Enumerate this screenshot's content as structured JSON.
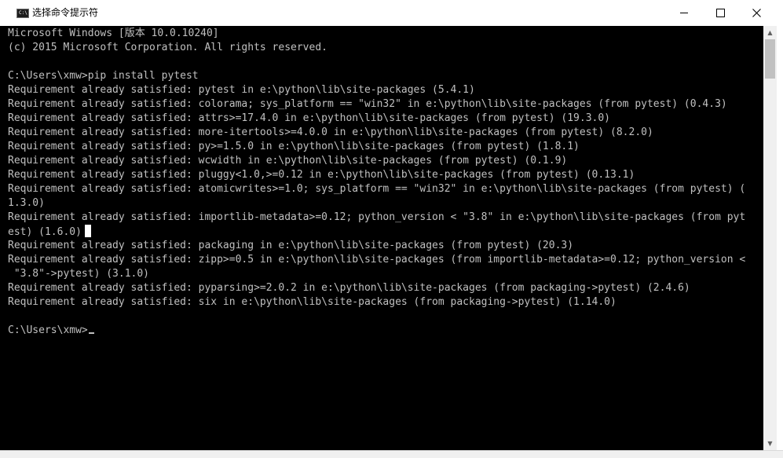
{
  "window": {
    "title": "选择命令提示符",
    "icon_label": "C:\\",
    "controls": {
      "minimize": "minimize",
      "maximize": "maximize",
      "close": "close"
    }
  },
  "console": {
    "lines": [
      "Microsoft Windows [版本 10.0.10240]",
      "(c) 2015 Microsoft Corporation. All rights reserved.",
      "",
      "C:\\Users\\xmw>pip install pytest",
      "Requirement already satisfied: pytest in e:\\python\\lib\\site-packages (5.4.1)",
      "Requirement already satisfied: colorama; sys_platform == \"win32\" in e:\\python\\lib\\site-packages (from pytest) (0.4.3)",
      "Requirement already satisfied: attrs>=17.4.0 in e:\\python\\lib\\site-packages (from pytest) (19.3.0)",
      "Requirement already satisfied: more-itertools>=4.0.0 in e:\\python\\lib\\site-packages (from pytest) (8.2.0)",
      "Requirement already satisfied: py>=1.5.0 in e:\\python\\lib\\site-packages (from pytest) (1.8.1)",
      "Requirement already satisfied: wcwidth in e:\\python\\lib\\site-packages (from pytest) (0.1.9)",
      "Requirement already satisfied: pluggy<1.0,>=0.12 in e:\\python\\lib\\site-packages (from pytest) (0.13.1)",
      "Requirement already satisfied: atomicwrites>=1.0; sys_platform == \"win32\" in e:\\python\\lib\\site-packages (from pytest) (",
      "1.3.0)",
      "Requirement already satisfied: importlib-metadata>=0.12; python_version < \"3.8\" in e:\\python\\lib\\site-packages (from pyt",
      "est) (1.6.0)",
      "Requirement already satisfied: packaging in e:\\python\\lib\\site-packages (from pytest) (20.3)",
      "Requirement already satisfied: zipp>=0.5 in e:\\python\\lib\\site-packages (from importlib-metadata>=0.12; python_version <",
      " \"3.8\"->pytest) (3.1.0)",
      "Requirement already satisfied: pyparsing>=2.0.2 in e:\\python\\lib\\site-packages (from packaging->pytest) (2.4.6)",
      "Requirement already satisfied: six in e:\\python\\lib\\site-packages (from packaging->pytest) (1.14.0)",
      "",
      "C:\\Users\\xmw>"
    ],
    "selection_cursor_line": 14,
    "prompt_cursor_line": 21,
    "colors": {
      "background": "#000000",
      "text": "#c0c0c0",
      "selection_cursor": "#ffffff"
    }
  },
  "scrollbar": {
    "up_icon": "scroll-up-arrow-icon",
    "down_icon": "scroll-down-arrow-icon"
  }
}
